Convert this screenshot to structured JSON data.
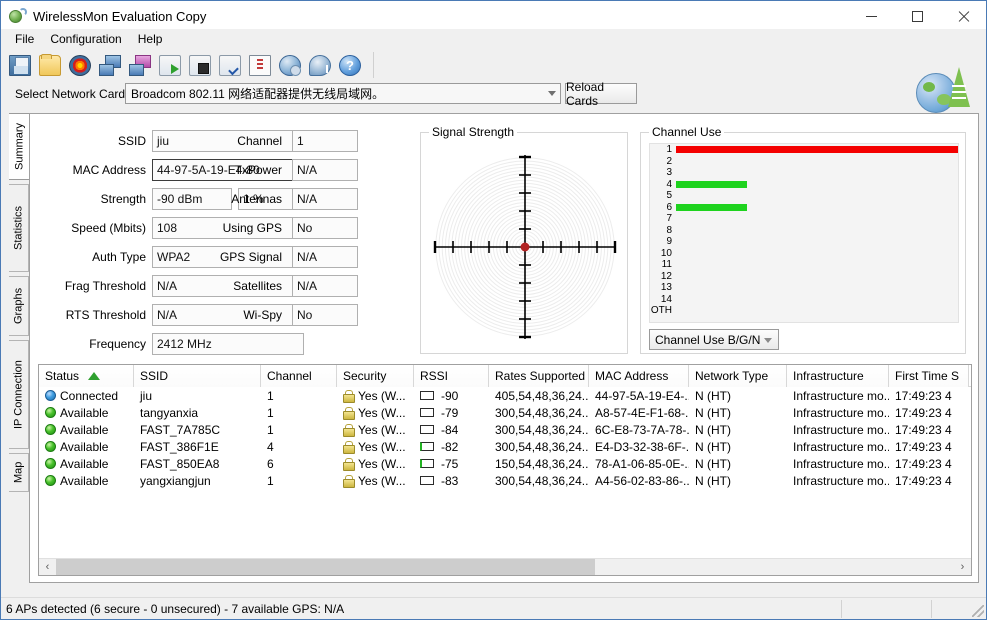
{
  "window": {
    "title": "WirelessMon Evaluation Copy",
    "icon": "wirelessmon-app-icon",
    "minimize": "—",
    "maximize": "□",
    "close": "✕"
  },
  "menu": {
    "items": [
      {
        "label": "File"
      },
      {
        "label": "Configuration"
      },
      {
        "label": "Help"
      }
    ]
  },
  "toolbar": {
    "buttons": [
      {
        "icon": "save-icon",
        "cls": "ico-save"
      },
      {
        "icon": "open-folder-icon",
        "cls": "ico-folder"
      },
      {
        "icon": "radar-scan-icon",
        "cls": "ico-radar"
      },
      {
        "icon": "network-cards-blue-icon",
        "cls": "ico-net1"
      },
      {
        "icon": "network-cards-purple-icon",
        "cls": "ico-net2"
      },
      {
        "icon": "start-logging-icon",
        "cls": "ico-export"
      },
      {
        "icon": "stop-logging-icon",
        "cls": "ico-device"
      },
      {
        "icon": "verify-log-icon",
        "cls": "ico-check"
      },
      {
        "icon": "report-icon",
        "cls": "ico-report"
      },
      {
        "icon": "globe-icon",
        "cls": "ico-globe"
      },
      {
        "icon": "info-balloon-icon",
        "cls": "ico-speech"
      },
      {
        "icon": "help-icon",
        "cls": "ico-help"
      }
    ]
  },
  "card_select": {
    "label": "Select Network Card",
    "value": "Broadcom 802.11 网络适配器提供无线局域网。",
    "reload_label": "Reload Cards",
    "logo_icon": "globe-signal-tower-icon"
  },
  "tabs": {
    "items": [
      {
        "label": "Summary",
        "selected": true
      },
      {
        "label": "Statistics",
        "selected": false
      },
      {
        "label": "Graphs",
        "selected": false
      },
      {
        "label": "IP Connection",
        "selected": false
      },
      {
        "label": "Map",
        "selected": false
      }
    ]
  },
  "summary": {
    "left_fields": [
      {
        "label": "SSID",
        "value": "jiu",
        "focused": false
      },
      {
        "label": "MAC Address",
        "value": "44-97-5A-19-E4-80",
        "focused": true
      },
      {
        "label": "Strength",
        "value": "-90 dBm",
        "value2": "1 %",
        "focused": false
      },
      {
        "label": "Speed (Mbits)",
        "value": "108",
        "focused": false
      },
      {
        "label": "Auth Type",
        "value": "WPA2",
        "focused": false
      },
      {
        "label": "Frag Threshold",
        "value": "N/A",
        "focused": false
      },
      {
        "label": "RTS Threshold",
        "value": "N/A",
        "focused": false
      },
      {
        "label": "Frequency",
        "value": "2412 MHz",
        "focused": false
      }
    ],
    "right_fields": [
      {
        "label": "Channel",
        "value": "1"
      },
      {
        "label": "TxPower",
        "value": "N/A"
      },
      {
        "label": "Antennas",
        "value": "N/A"
      },
      {
        "label": "Using GPS",
        "value": "No"
      },
      {
        "label": "GPS Signal",
        "value": "N/A"
      },
      {
        "label": "Satellites",
        "value": "N/A"
      },
      {
        "label": "Wi-Spy",
        "value": "No"
      }
    ]
  },
  "signal_strength": {
    "title": "Signal Strength",
    "center_dot_color": "#b22222"
  },
  "chart_data": {
    "type": "bar",
    "title": "Channel Use",
    "orientation": "horizontal",
    "xlabel": "",
    "ylabel": "Channel",
    "xlim": [
      0,
      100
    ],
    "grid": false,
    "legend": "none",
    "categories": [
      "1",
      "2",
      "3",
      "4",
      "5",
      "6",
      "7",
      "8",
      "9",
      "10",
      "11",
      "12",
      "13",
      "14",
      "OTH"
    ],
    "values": [
      100,
      0,
      0,
      25,
      0,
      25,
      0,
      0,
      0,
      0,
      0,
      0,
      0,
      0,
      0
    ],
    "colors": [
      "#f40000",
      "#f40000",
      "#f40000",
      "#1ed31e",
      "#1ed31e",
      "#1ed31e",
      "#1ed31e",
      "#1ed31e",
      "#1ed31e",
      "#1ed31e",
      "#1ed31e",
      "#1ed31e",
      "#1ed31e",
      "#1ed31e",
      "#1ed31e"
    ],
    "selector_value": "Channel Use B/G/N"
  },
  "ap_table": {
    "columns": [
      {
        "label": "Status",
        "width": 95,
        "sorted": true
      },
      {
        "label": "SSID",
        "width": 127
      },
      {
        "label": "Channel",
        "width": 76
      },
      {
        "label": "Security",
        "width": 77
      },
      {
        "label": "RSSI",
        "width": 75
      },
      {
        "label": "Rates Supported",
        "width": 100
      },
      {
        "label": "MAC Address",
        "width": 100
      },
      {
        "label": "Network Type",
        "width": 98
      },
      {
        "label": "Infrastructure",
        "width": 102
      },
      {
        "label": "First Time S",
        "width": 80
      }
    ],
    "rows": [
      {
        "status": "Connected",
        "status_kind": "connected",
        "ssid": "jiu",
        "channel": "1",
        "security": "Yes (W...",
        "rssi": "-90",
        "rssi_lit": false,
        "rates": "405,54,48,36,24...",
        "mac": "44-97-5A-19-E4-...",
        "network_type": "N (HT)",
        "infrastructure": "Infrastructure mo...",
        "first_time": "17:49:23 4"
      },
      {
        "status": "Available",
        "status_kind": "available",
        "ssid": "tangyanxia",
        "channel": "1",
        "security": "Yes (W...",
        "rssi": "-79",
        "rssi_lit": false,
        "rates": "300,54,48,36,24...",
        "mac": "A8-57-4E-F1-68-...",
        "network_type": "N (HT)",
        "infrastructure": "Infrastructure mo...",
        "first_time": "17:49:23 4"
      },
      {
        "status": "Available",
        "status_kind": "available",
        "ssid": "FAST_7A785C",
        "channel": "1",
        "security": "Yes (W...",
        "rssi": "-84",
        "rssi_lit": false,
        "rates": "300,54,48,36,24...",
        "mac": "6C-E8-73-7A-78-...",
        "network_type": "N (HT)",
        "infrastructure": "Infrastructure mo...",
        "first_time": "17:49:23 4"
      },
      {
        "status": "Available",
        "status_kind": "available",
        "ssid": "FAST_386F1E",
        "channel": "4",
        "security": "Yes (W...",
        "rssi": "-82",
        "rssi_lit": true,
        "rates": "300,54,48,36,24...",
        "mac": "E4-D3-32-38-6F-...",
        "network_type": "N (HT)",
        "infrastructure": "Infrastructure mo...",
        "first_time": "17:49:23 4"
      },
      {
        "status": "Available",
        "status_kind": "available",
        "ssid": "FAST_850EA8",
        "channel": "6",
        "security": "Yes (W...",
        "rssi": "-75",
        "rssi_lit": true,
        "rates": "150,54,48,36,24...",
        "mac": "78-A1-06-85-0E-...",
        "network_type": "N (HT)",
        "infrastructure": "Infrastructure mo...",
        "first_time": "17:49:23 4"
      },
      {
        "status": "Available",
        "status_kind": "available",
        "ssid": "yangxiangjun",
        "channel": "1",
        "security": "Yes (W...",
        "rssi": "-83",
        "rssi_lit": false,
        "rates": "300,54,48,36,24...",
        "mac": "A4-56-02-83-86-...",
        "network_type": "N (HT)",
        "infrastructure": "Infrastructure mo...",
        "first_time": "17:49:23 4"
      }
    ],
    "scroll_left_arrow": "‹",
    "scroll_right_arrow": "›"
  },
  "statusbar": {
    "text": "6 APs detected (6 secure - 0 unsecured) - 7 available GPS: N/A"
  }
}
